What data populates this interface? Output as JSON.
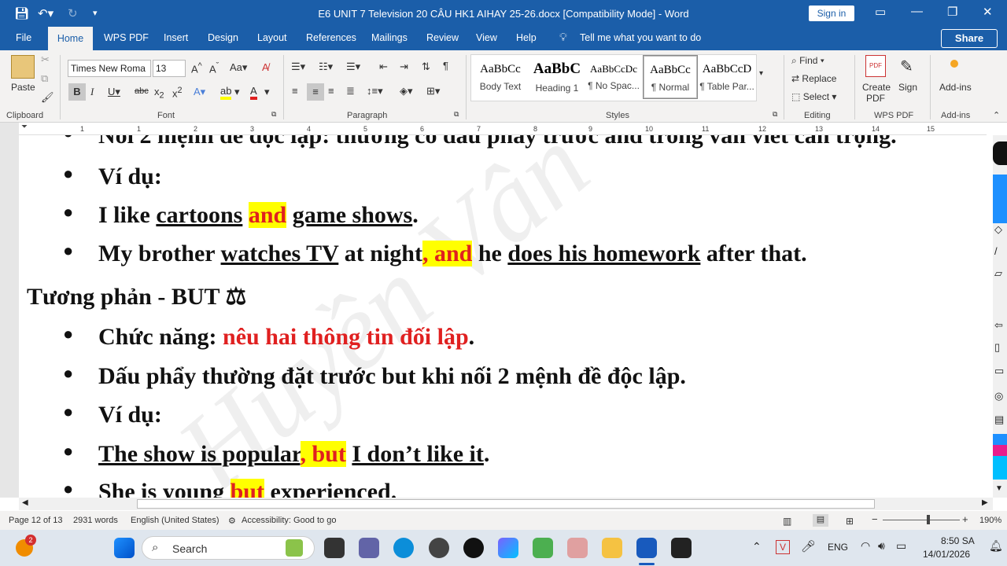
{
  "window": {
    "doc_title": "E6 UNIT 7 Television 20 CÂU HK1 AIHAY 25-26.docx [Compatibility Mode]  -  Word",
    "sign_in": "Sign in"
  },
  "tabs": [
    "File",
    "Home",
    "WPS PDF",
    "Insert",
    "Design",
    "Layout",
    "References",
    "Mailings",
    "Review",
    "View",
    "Help"
  ],
  "tell_me": "Tell me what you want to do",
  "share_label": "Share",
  "ribbon": {
    "paste_label": "Paste",
    "font_name": "Times New Roma",
    "font_size": "13",
    "groups": {
      "clipboard": "Clipboard",
      "font": "Font",
      "paragraph": "Paragraph",
      "styles": "Styles",
      "editing": "Editing",
      "wps_pdf": "WPS PDF",
      "add_ins": "Add-ins"
    },
    "styles": [
      {
        "preview": "AaBbCc",
        "name": "Body Text"
      },
      {
        "preview": "AaBbC",
        "name": "Heading 1"
      },
      {
        "preview": "AaBbCcDc",
        "name": "¶ No Spac..."
      },
      {
        "preview": "AaBbCc",
        "name": "¶ Normal"
      },
      {
        "preview": "AaBbCcD",
        "name": "¶ Table Par..."
      }
    ],
    "editing": {
      "find": "Find",
      "replace": "Replace",
      "select": "Select"
    },
    "create_pdf": "Create PDF",
    "sign": "Sign",
    "add_ins": "Add-ins"
  },
  "ruler_numbers": [
    "1",
    "1",
    "2",
    "3",
    "4",
    "5",
    "6",
    "7",
    "8",
    "9",
    "10",
    "11",
    "12",
    "13",
    "14",
    "15",
    "16"
  ],
  "document": {
    "line0": "Nối 2 mệnh đề độc lập: thường có dấu phẩy trước and trong văn viết cẩn trọng.",
    "line1": "Ví dụ:",
    "line2": {
      "a": "I like ",
      "b": "cartoons",
      "c": " ",
      "d": "and",
      "e": " ",
      "f": "game shows",
      "g": "."
    },
    "line3": {
      "a": "My brother ",
      "b": "watches TV",
      "c": " at night",
      "d": ", and",
      "e": " he ",
      "f": "does his homework",
      "g": " after that."
    },
    "heading": "Tương phản - BUT ⚖",
    "line4": {
      "a": "Chức năng: ",
      "b": "nêu hai thông tin đối lập",
      "c": "."
    },
    "line5": "Dấu phẩy thường đặt trước but khi nối 2 mệnh đề độc lập.",
    "line6": "Ví dụ:",
    "line7": {
      "a": "The show is popular",
      "b": ", but",
      "c": " ",
      "d": "I don’t like it",
      "e": "."
    },
    "line8": {
      "a": "She is young ",
      "b": "but",
      "c": " experienced."
    },
    "watermark": "Huyền Vân"
  },
  "status": {
    "page": "Page 12 of 13",
    "words": "2931 words",
    "language": "English (United States)",
    "accessibility": "Accessibility: Good to go",
    "zoom": "190%"
  },
  "taskbar": {
    "search": "Search",
    "badge": "2",
    "lang": "ENG",
    "time": "8:50 SA",
    "date": "14/01/2026"
  },
  "colors": {
    "word_blue": "#1b5ea9",
    "highlight": "#ffff00",
    "red_text": "#e02020"
  }
}
